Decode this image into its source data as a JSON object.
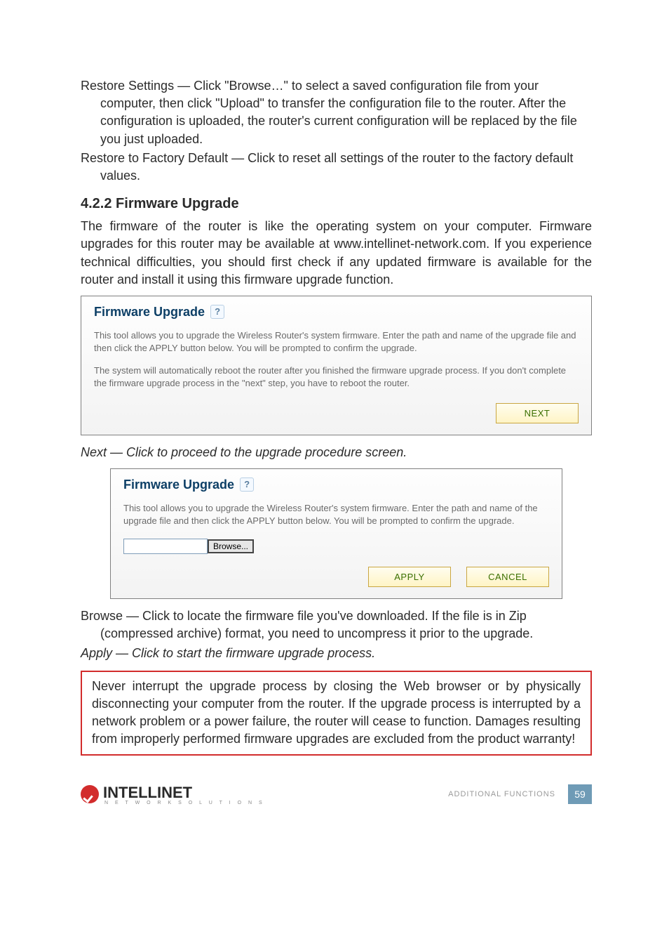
{
  "para_restore_settings": "Restore Settings — Click \"Browse…\" to select a saved configuration file from your computer, then click \"Upload\" to transfer the configuration file to the router. After the configuration is uploaded, the router's current configuration will be replaced by the file you just uploaded.",
  "para_restore_factory": "Restore to Factory Default — Click to reset all settings of the router to the factory default values.",
  "section_heading": "4.2.2  Firmware Upgrade",
  "intro_paragraph": "The firmware of the router is like the operating system on your computer. Firmware upgrades for this router may be available at www.intellinet-network.com. If you experience technical difficulties, you should first check if any updated firmware is available for the router and install it using this firmware upgrade function.",
  "panel1": {
    "title": "Firmware Upgrade",
    "help": "?",
    "desc1": "This tool allows you to upgrade the Wireless Router's system firmware. Enter the path and name of the upgrade file and then click the APPLY button below. You will be prompted to confirm the upgrade.",
    "desc2": "The system will automatically reboot the router after you finished the firmware upgrade process. If you don't complete the firmware upgrade process in the \"next\" step, you have to reboot the router.",
    "next_label": "NEXT"
  },
  "next_caption": "Next — Click to proceed to the upgrade procedure screen.",
  "panel2": {
    "title": "Firmware Upgrade",
    "help": "?",
    "desc": "This tool allows you to upgrade the Wireless Router's system firmware. Enter the path and name of the upgrade file and then click the APPLY button below. You will be prompted to confirm the upgrade.",
    "browse_label": "Browse...",
    "apply_label": "APPLY",
    "cancel_label": "CANCEL"
  },
  "browse_caption": "Browse — Click to locate the firmware file you've downloaded. If the file is in Zip (compressed archive) format, you need to uncompress it prior to the upgrade.",
  "apply_caption": "Apply — Click to start the firmware upgrade process.",
  "warning_text": "Never interrupt the upgrade process by closing the Web browser or by physically disconnecting your computer from the router. If the upgrade process is interrupted by a network problem or a power failure, the router will cease to function. Damages resulting from improperly performed firmware upgrades are excluded from the product warranty!",
  "footer": {
    "brand": "INTELLINET",
    "tag": "N E T W O R K   S O L U T I O N S",
    "section_label": "ADDITIONAL FUNCTIONS",
    "page_number": "59"
  }
}
